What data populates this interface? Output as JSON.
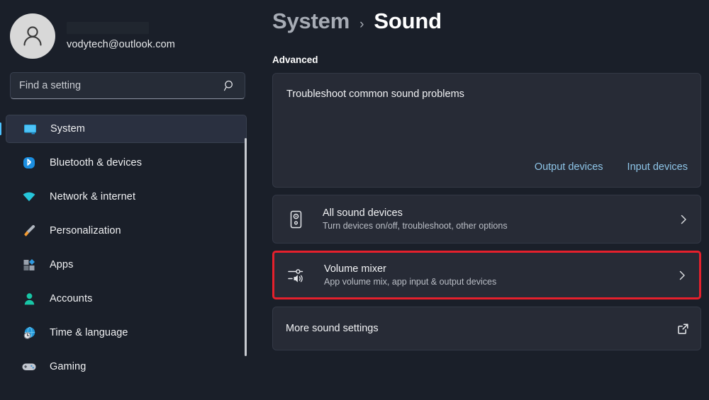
{
  "account": {
    "name_redacted": true,
    "email": "vodytech@outlook.com",
    "avatar_icon": "person-avatar-icon"
  },
  "search": {
    "placeholder": "Find a setting",
    "value": "",
    "icon": "search-icon"
  },
  "sidebar": {
    "items": [
      {
        "label": "System",
        "icon": "monitor-icon",
        "selected": true
      },
      {
        "label": "Bluetooth & devices",
        "icon": "bluetooth-icon",
        "selected": false
      },
      {
        "label": "Network & internet",
        "icon": "wifi-icon",
        "selected": false
      },
      {
        "label": "Personalization",
        "icon": "paintbrush-icon",
        "selected": false
      },
      {
        "label": "Apps",
        "icon": "apps-grid-icon",
        "selected": false
      },
      {
        "label": "Accounts",
        "icon": "person-icon",
        "selected": false
      },
      {
        "label": "Time & language",
        "icon": "globe-clock-icon",
        "selected": false
      },
      {
        "label": "Gaming",
        "icon": "gamepad-icon",
        "selected": false
      }
    ]
  },
  "header": {
    "breadcrumb_parent": "System",
    "breadcrumb_separator": "›",
    "breadcrumb_current": "Sound"
  },
  "main": {
    "section_title": "Advanced",
    "troubleshoot": {
      "title": "Troubleshoot common sound problems",
      "link_output": "Output devices",
      "link_input": "Input devices"
    },
    "rows": [
      {
        "title": "All sound devices",
        "subtitle": "Turn devices on/off, troubleshoot, other options",
        "icon": "speaker-device-icon",
        "action_icon": "chevron-right-icon",
        "highlighted": false
      },
      {
        "title": "Volume mixer",
        "subtitle": "App volume mix, app input & output devices",
        "icon": "volume-mixer-icon",
        "action_icon": "chevron-right-icon",
        "highlighted": true
      },
      {
        "title": "More sound settings",
        "subtitle": "",
        "icon": "",
        "action_icon": "external-link-icon",
        "highlighted": false
      }
    ]
  },
  "colors": {
    "page_background": "#1a1f29",
    "card_background": "#272b36",
    "accent_link": "#8ec5e8",
    "selection_accent": "#4cc2ff",
    "highlight_border": "#e5202c"
  }
}
